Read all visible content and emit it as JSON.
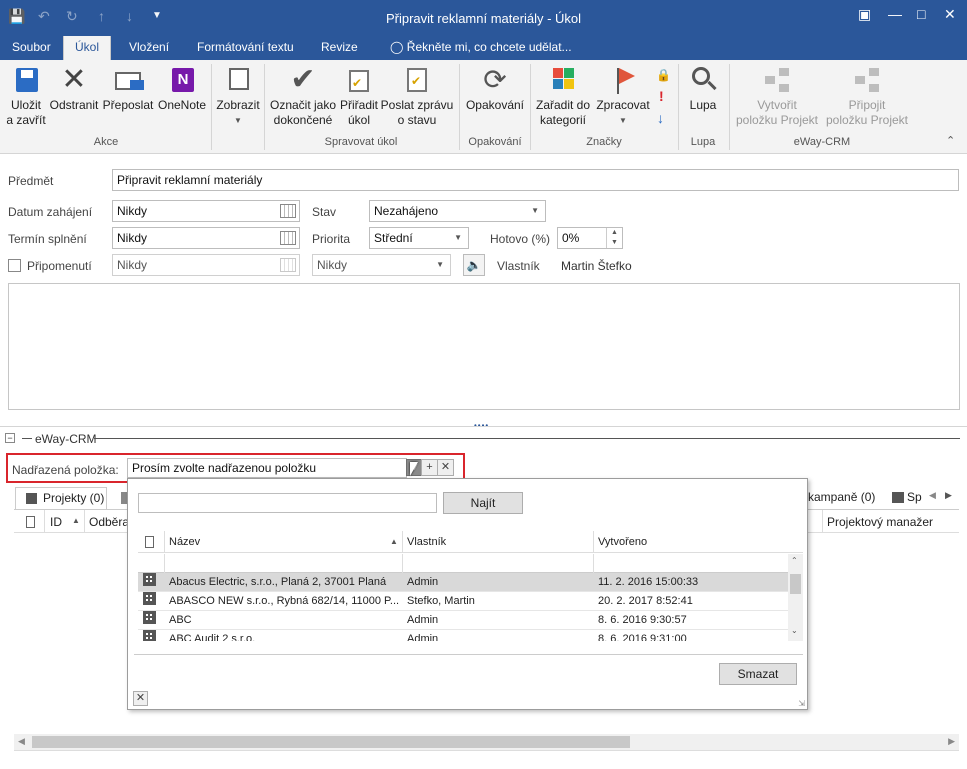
{
  "window": {
    "title": "Připravit reklamní materiály - Úkol"
  },
  "ribbon_tabs": [
    "Soubor",
    "Úkol",
    "Vložení",
    "Formátování textu",
    "Revize"
  ],
  "tell_me": "Řekněte mi, co chcete udělat...",
  "ribbon": {
    "buttons": {
      "save_close": "Uložit\na zavřít",
      "delete": "Odstranit",
      "forward": "Přeposlat",
      "onenote": "OneNote",
      "show": "Zobrazit",
      "mark_complete": "Označit jako\ndokončené",
      "assign": "Přiřadit\núkol",
      "send_status": "Poslat zprávu\no stavu",
      "recurrence": "Opakování",
      "categorize": "Zařadit do\nkategorií",
      "follow_up": "Zpracovat",
      "zoom": "Lupa",
      "create_project": "Vytvořit\npoložku Projekt",
      "link_project": "Připojit\npoložku Projekt"
    },
    "groups": {
      "actions": "Akce",
      "manage": "Spravovat úkol",
      "recurrence": "Opakování",
      "tags": "Značky",
      "zoom": "Lupa",
      "eway": "eWay-CRM"
    }
  },
  "form": {
    "subject_label": "Předmět",
    "subject_value": "Připravit reklamní materiály",
    "start_label": "Datum zahájení",
    "start_value": "Nikdy",
    "due_label": "Termín splnění",
    "due_value": "Nikdy",
    "reminder_label": "Připomenutí",
    "reminder_value": "Nikdy",
    "reminder_time": "Nikdy",
    "status_label": "Stav",
    "status_value": "Nezahájeno",
    "priority_label": "Priorita",
    "priority_value": "Střední",
    "complete_label": "Hotovo (%)",
    "complete_value": "0%",
    "owner_label": "Vlastník",
    "owner_value": "Martin Štefko"
  },
  "eway": {
    "section_title": "eWay-CRM",
    "parent_label": "Nadřazená položka:",
    "parent_placeholder": "Prosím zvolte nadřazenou položku",
    "tabs": {
      "projects": "Projekty (0)",
      "campaigns": "kampaně (0)",
      "sp": "Sp"
    },
    "columns": {
      "id": "ID",
      "customer": "Odběra",
      "manager": "Projektový manažer"
    }
  },
  "popup": {
    "find_button": "Najít",
    "columns": [
      "Název",
      "Vlastník",
      "Vytvořeno"
    ],
    "rows": [
      {
        "name": "Abacus Electric, s.r.o., Planá 2, 37001 Planá",
        "owner": "Admin",
        "created": "11. 2. 2016 15:00:33"
      },
      {
        "name": "ABASCO NEW s.r.o., Rybná 682/14, 11000 P...",
        "owner": "Stefko, Martin",
        "created": "20. 2. 2017 8:52:41"
      },
      {
        "name": "ABC",
        "owner": "Admin",
        "created": "8. 6. 2016 9:30:57"
      },
      {
        "name": "ABC Audit 2 s.r.o.",
        "owner": "Admin",
        "created": "8. 6. 2016 9:31:00"
      }
    ],
    "clear_button": "Smazat"
  },
  "colors": {
    "accent": "#2b579a",
    "highlight_border": "#d9252c"
  }
}
